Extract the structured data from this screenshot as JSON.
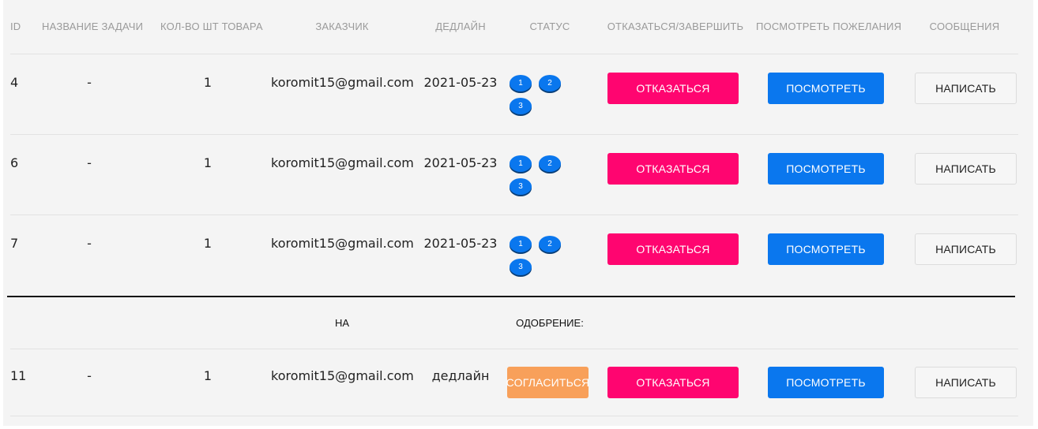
{
  "columns": {
    "id": "ID",
    "name": "НАЗВАНИЕ ЗАДАЧИ",
    "qty": "КОЛ-ВО ШТ ТОВАРА",
    "customer": "ЗАКАЗЧИК",
    "deadline": "ДЕДЛАЙН",
    "status": "СТАТУС",
    "action": "ОТКАЗАТЬСЯ/ЗАВЕРШИТЬ",
    "wishes": "ПОСМОТРЕТЬ ПОЖЕЛАНИЯ",
    "messages": "СООБЩЕНИЯ"
  },
  "rows": [
    {
      "id": "4",
      "name": "-",
      "qty": "1",
      "customer": "koromit15@gmail.com",
      "deadline": "2021-05-23",
      "status_steps": [
        "1",
        "2",
        "3"
      ],
      "refuse_label": "ОТКАЗАТЬСЯ",
      "view_label": "ПОСМОТРЕТЬ",
      "write_label": "НАПИСАТЬ"
    },
    {
      "id": "6",
      "name": "-",
      "qty": "1",
      "customer": "koromit15@gmail.com",
      "deadline": "2021-05-23",
      "status_steps": [
        "1",
        "2",
        "3"
      ],
      "refuse_label": "ОТКАЗАТЬСЯ",
      "view_label": "ПОСМОТРЕТЬ",
      "write_label": "НАПИСАТЬ"
    },
    {
      "id": "7",
      "name": "-",
      "qty": "1",
      "customer": "koromit15@gmail.com",
      "deadline": "2021-05-23",
      "status_steps": [
        "1",
        "2",
        "3"
      ],
      "refuse_label": "ОТКАЗАТЬСЯ",
      "view_label": "ПОСМОТРЕТЬ",
      "write_label": "НАПИСАТЬ"
    }
  ],
  "approval_section": {
    "header_left": "НА",
    "header_right": "ОДОБРЕНИЕ:",
    "rows": [
      {
        "id": "11",
        "name": "-",
        "qty": "1",
        "customer": "koromit15@gmail.com",
        "deadline": "дедлайн",
        "agree_label": "СОГЛАСИТЬСЯ",
        "refuse_label": "ОТКАЗАТЬСЯ",
        "view_label": "ПОСМОТРЕТЬ",
        "write_label": "НАПИСАТЬ"
      }
    ]
  },
  "colors": {
    "refuse": "#ff0570",
    "view": "#0a77ee",
    "agree": "#f8a05a",
    "status_bubble": "#0a77ee",
    "panel_bg": "#f4f4f4"
  }
}
